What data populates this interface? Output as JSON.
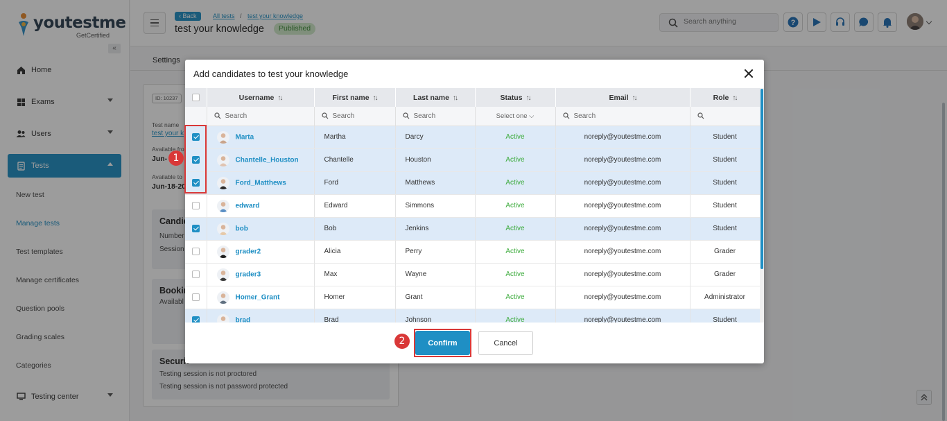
{
  "logo": {
    "text_you": "youtest",
    "text_me": "me",
    "sub": "GetCertified"
  },
  "sidebar": {
    "items": [
      {
        "label": "Home",
        "icon": "home-icon"
      },
      {
        "label": "Exams",
        "icon": "exams-icon"
      },
      {
        "label": "Users",
        "icon": "users-icon"
      },
      {
        "label": "Tests",
        "icon": "tests-icon"
      }
    ],
    "sub_items": [
      {
        "label": "New test"
      },
      {
        "label": "Manage tests"
      },
      {
        "label": "Test templates"
      },
      {
        "label": "Manage certificates"
      },
      {
        "label": "Question pools"
      },
      {
        "label": "Grading scales"
      },
      {
        "label": "Categories"
      }
    ],
    "testing_center": "Testing center"
  },
  "header": {
    "back": "Back",
    "crumb1": "All tests",
    "crumb_sep": "/",
    "crumb2": "test your knowledge",
    "title": "test your knowledge",
    "status": "Published",
    "search_placeholder": "Search anything"
  },
  "background": {
    "tab_settings": "Settings",
    "id_badge": "ID: 10237",
    "test_name_label": "Test name",
    "test_name_value": "test your k",
    "available_from_label": "Available fro",
    "available_from_value": "Jun-",
    "available_to_label": "Available to",
    "available_to_value": "Jun-18-20",
    "box1_title": "Candid",
    "box1_line1": "Number",
    "box1_line2": "Session",
    "box2_title": "Bookin",
    "box2_line1": "Availabl",
    "box3_title": "Securit",
    "box3_line1": "Testing session is not proctored",
    "box3_line2": "Testing session is not password protected"
  },
  "modal": {
    "title": "Add candidates to test your knowledge",
    "columns": [
      "Username",
      "First name",
      "Last name",
      "Status",
      "Email",
      "Role"
    ],
    "filter_search": "Search",
    "filter_select": "Select one",
    "rows": [
      {
        "username": "Marta",
        "first": "Martha",
        "last": "Darcy",
        "status": "Active",
        "email": "noreply@youtestme.com",
        "role": "Student",
        "checked": true
      },
      {
        "username": "Chantelle_Houston",
        "first": "Chantelle",
        "last": "Houston",
        "status": "Active",
        "email": "noreply@youtestme.com",
        "role": "Student",
        "checked": true
      },
      {
        "username": "Ford_Matthews",
        "first": "Ford",
        "last": "Matthews",
        "status": "Active",
        "email": "noreply@youtestme.com",
        "role": "Student",
        "checked": true
      },
      {
        "username": "edward",
        "first": "Edward",
        "last": "Simmons",
        "status": "Active",
        "email": "noreply@youtestme.com",
        "role": "Student",
        "checked": false
      },
      {
        "username": "bob",
        "first": "Bob",
        "last": "Jenkins",
        "status": "Active",
        "email": "noreply@youtestme.com",
        "role": "Student",
        "checked": true
      },
      {
        "username": "grader2",
        "first": "Alicia",
        "last": "Perry",
        "status": "Active",
        "email": "noreply@youtestme.com",
        "role": "Grader",
        "checked": false
      },
      {
        "username": "grader3",
        "first": "Max",
        "last": "Wayne",
        "status": "Active",
        "email": "noreply@youtestme.com",
        "role": "Grader",
        "checked": false
      },
      {
        "username": "Homer_Grant",
        "first": "Homer",
        "last": "Grant",
        "status": "Active",
        "email": "noreply@youtestme.com",
        "role": "Administrator",
        "checked": false
      },
      {
        "username": "brad",
        "first": "Brad",
        "last": "Johnson",
        "status": "Active",
        "email": "noreply@youtestme.com",
        "role": "Student",
        "checked": true
      }
    ],
    "confirm": "Confirm",
    "cancel": "Cancel"
  },
  "annotations": {
    "step1": "1",
    "step2": "2"
  },
  "colors": {
    "accent": "#1f8fc4",
    "active": "#3cab3c",
    "annotation": "#d93838",
    "published_bg": "#cfe9c9"
  }
}
